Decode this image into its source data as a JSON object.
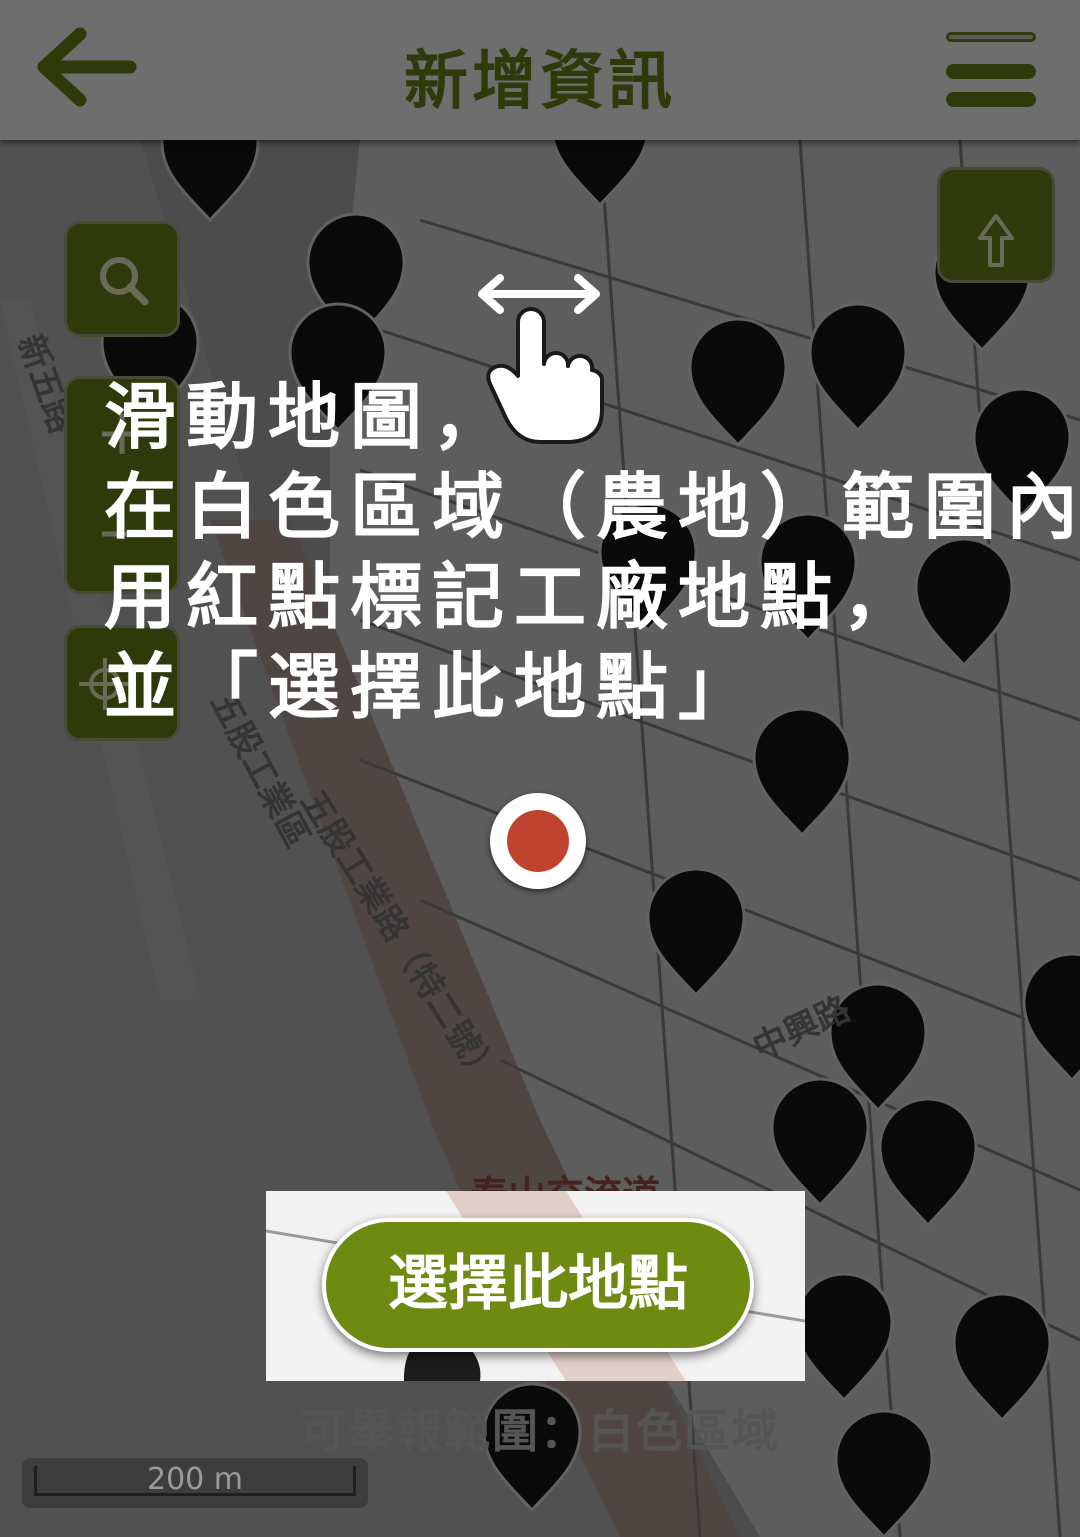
{
  "header": {
    "title": "新增資訊",
    "back_icon": "arrow-left-icon",
    "menu_icon": "hamburger-menu-icon"
  },
  "map_controls": {
    "search_icon": "search-icon",
    "zoom_in_icon": "plus-icon",
    "zoom_out_icon": "minus-icon",
    "locate_icon": "crosshair-icon",
    "up_icon": "arrow-up-icon"
  },
  "instruction": {
    "lines": [
      "滑動地圖，",
      "在白色區域（農地）範圍內",
      "用紅點標記工廠地點，",
      "並「選擇此地點」"
    ],
    "gesture_icon": "swipe-hand-icon"
  },
  "map_labels": {
    "road_1": "新五路",
    "road_2": "五股工業區",
    "road_3": "五股工業路（特二號）",
    "road_4": "中興路",
    "interchange": "泰山交流道"
  },
  "select_button": {
    "label": "選擇此地點"
  },
  "range_note": "可舉報範圍：白色區域",
  "scale": {
    "label": "200 m"
  },
  "colors": {
    "accent": "#6e8a10",
    "header_text": "#2e3a0a",
    "marker": "#c0432f"
  }
}
